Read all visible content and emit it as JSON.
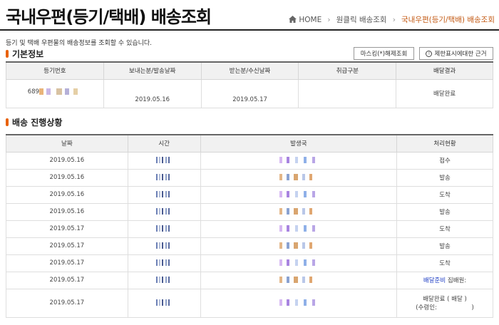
{
  "page_title": "국내우편(등기/택배) 배송조회",
  "breadcrumb": [
    {
      "label": "HOME",
      "icon": "home-icon"
    },
    {
      "label": "원클릭 배송조회"
    },
    {
      "label": "국내우편(등기/택배) 배송조회"
    }
  ],
  "description": "등기 및 택배 우편물의 배송정보를 조회할 수 있습니다.",
  "basic_info": {
    "title": "기본정보",
    "mask_button": "마스킹(*)해제조회",
    "basis_button": "제한표시에대한 근거",
    "headers": [
      "등기번호",
      "보내는분/발송날짜",
      "받는분/수신날짜",
      "취급구분",
      "배달결과"
    ],
    "row": {
      "tracking_prefix": "689",
      "send_date": "2019.05.16",
      "recv_date": "2019.05.17",
      "handling": "",
      "result": "배달완료"
    }
  },
  "progress": {
    "title": "배송 진행상황",
    "headers": [
      "날짜",
      "시간",
      "발생국",
      "처리현황"
    ],
    "rows": [
      {
        "date": "2019.05.16",
        "status": "접수"
      },
      {
        "date": "2019.05.16",
        "status": "발송"
      },
      {
        "date": "2019.05.16",
        "status": "도착"
      },
      {
        "date": "2019.05.16",
        "status": "발송"
      },
      {
        "date": "2019.05.17",
        "status": "도착"
      },
      {
        "date": "2019.05.17",
        "status": "발송"
      },
      {
        "date": "2019.05.17",
        "status": "도착"
      },
      {
        "date": "2019.05.17",
        "status_link": "배달준비",
        "status": " 집배원:"
      },
      {
        "date": "2019.05.17",
        "status": "배달완료 ( 배달 )",
        "status2": "(수령인:                  )"
      }
    ]
  },
  "colors": {
    "accent": "#e8620a",
    "breadcrumb_current": "#c35a14",
    "link": "#1f3ec4"
  }
}
